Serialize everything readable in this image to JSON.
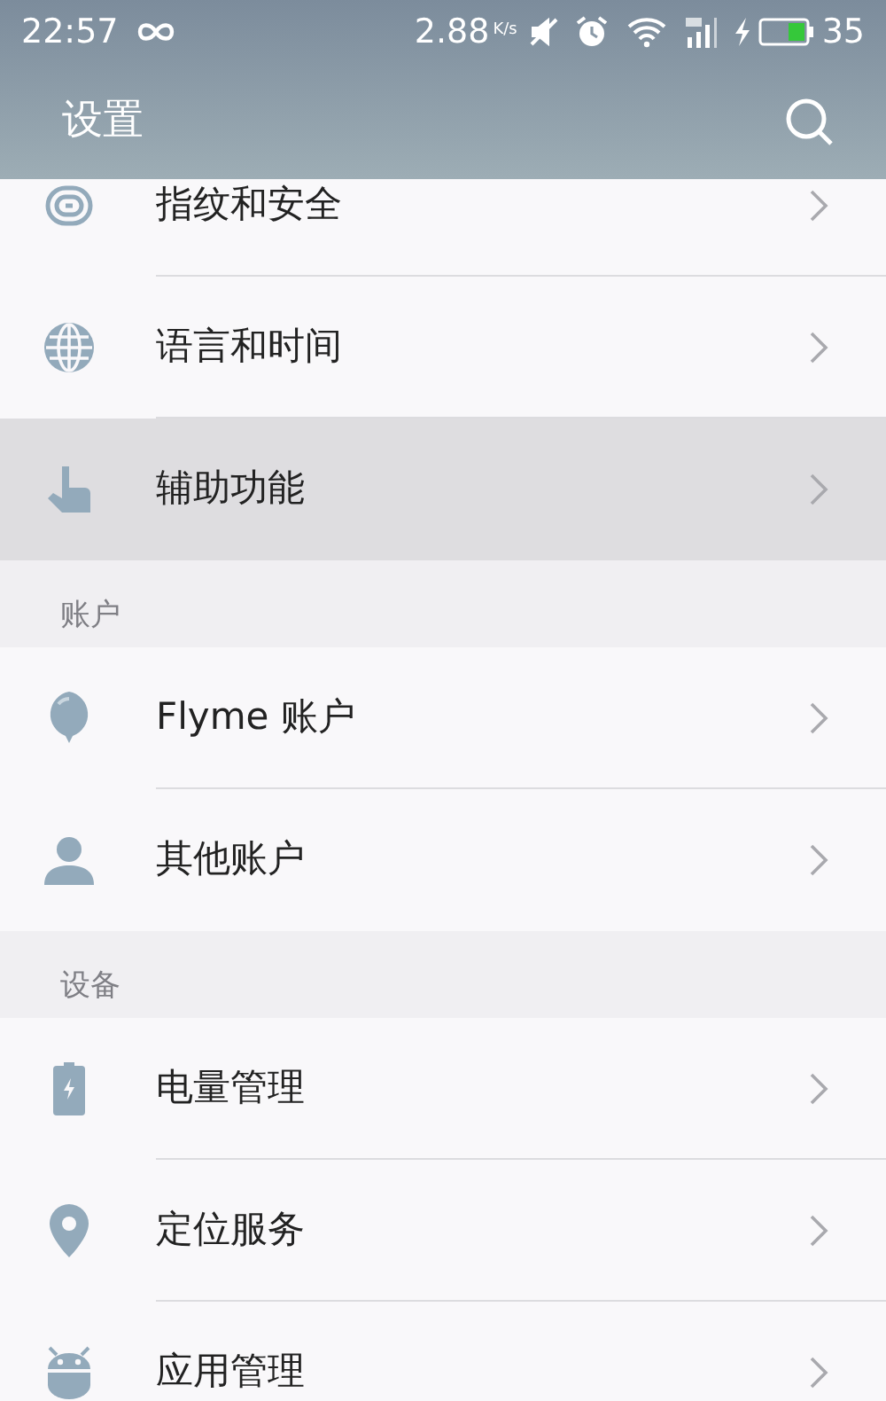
{
  "status_bar": {
    "time": "22:57",
    "speed": "2.88",
    "speed_unit": "K/s",
    "battery": "35"
  },
  "header": {
    "title": "设置"
  },
  "groups": [
    {
      "items": [
        {
          "label": "指纹和安全",
          "kind": "fingerprint",
          "pressed": false
        },
        {
          "label": "语言和时间",
          "kind": "globe",
          "pressed": false
        },
        {
          "label": "辅助功能",
          "kind": "hand",
          "pressed": true
        }
      ]
    },
    {
      "title": "账户",
      "items": [
        {
          "label": "Flyme 账户",
          "kind": "balloon",
          "pressed": false
        },
        {
          "label": "其他账户",
          "kind": "person",
          "pressed": false
        }
      ]
    },
    {
      "title": "设备",
      "items": [
        {
          "label": "电量管理",
          "kind": "battery",
          "pressed": false
        },
        {
          "label": "定位服务",
          "kind": "pin",
          "pressed": false
        },
        {
          "label": "应用管理",
          "kind": "robot",
          "pressed": false
        }
      ]
    }
  ]
}
